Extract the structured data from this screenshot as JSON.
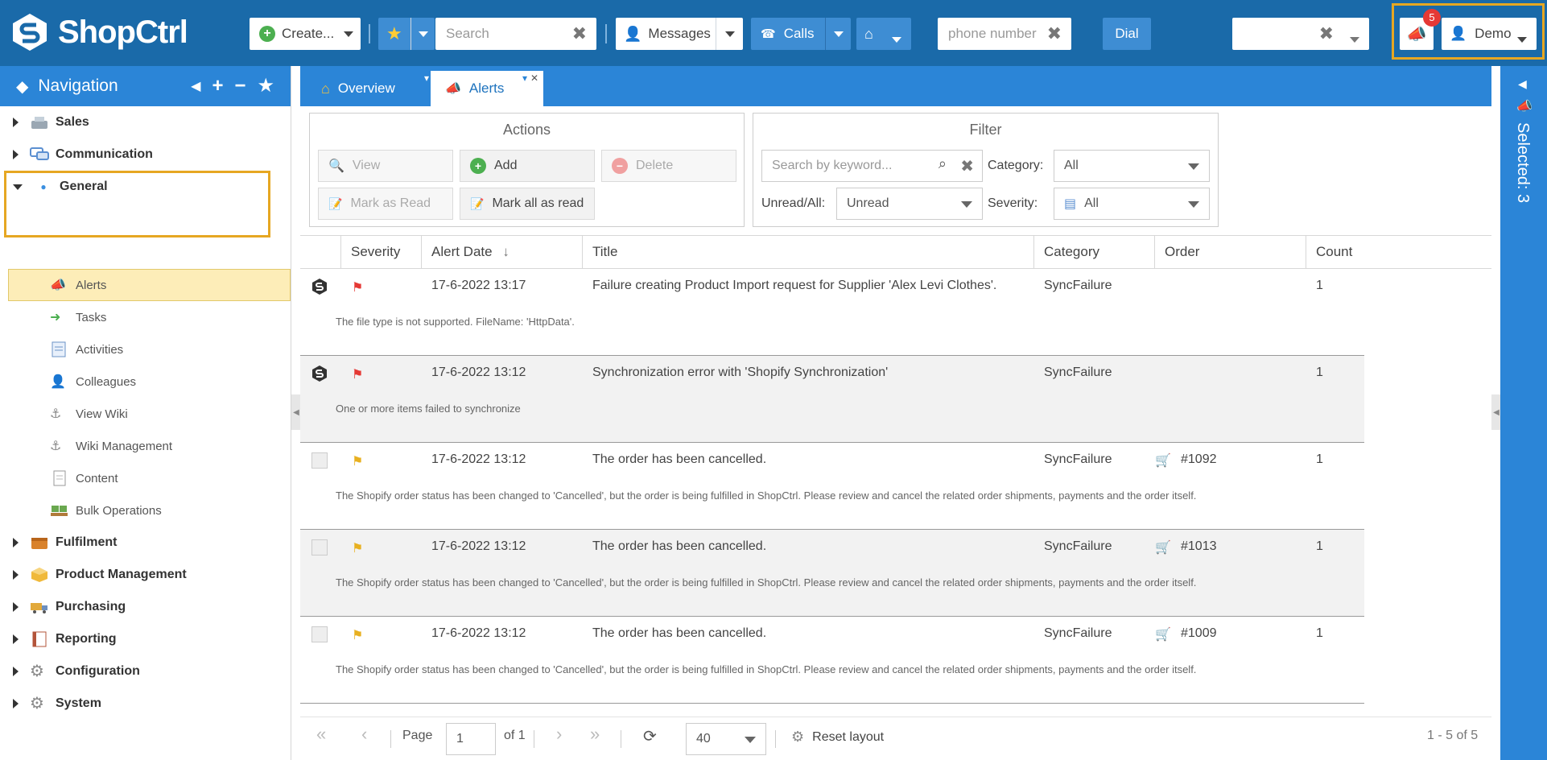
{
  "app": {
    "logo_text": "ShopCtrl"
  },
  "topbar": {
    "create_label": "Create...",
    "search_placeholder": "Search",
    "messages_label": "Messages",
    "calls_label": "Calls",
    "phone_placeholder": "phone number",
    "dial_label": "Dial",
    "user_label": "Demo",
    "alert_count": "5",
    "clear_glyph": "✖"
  },
  "nav": {
    "title": "Navigation",
    "items": [
      {
        "label": "Sales",
        "icon": "cash-register-icon",
        "type": "group"
      },
      {
        "label": "Communication",
        "icon": "chat-bubbles-icon",
        "type": "group"
      },
      {
        "label": "General",
        "icon": "dot-icon",
        "type": "group-open"
      },
      {
        "label": "Alerts",
        "icon": "megaphone-icon",
        "type": "sub"
      },
      {
        "label": "Tasks",
        "icon": "green-arrow-icon",
        "type": "sub"
      },
      {
        "label": "Activities",
        "icon": "notepad-icon",
        "type": "sub"
      },
      {
        "label": "Colleagues",
        "icon": "person-icon",
        "type": "sub"
      },
      {
        "label": "View Wiki",
        "icon": "anchor-icon",
        "type": "sub"
      },
      {
        "label": "Wiki Management",
        "icon": "anchor-icon",
        "type": "sub"
      },
      {
        "label": "Content",
        "icon": "document-icon",
        "type": "sub"
      },
      {
        "label": "Bulk Operations",
        "icon": "pallet-icon",
        "type": "sub"
      },
      {
        "label": "Fulfilment",
        "icon": "box-icon",
        "type": "group"
      },
      {
        "label": "Product Management",
        "icon": "cube-icon",
        "type": "group"
      },
      {
        "label": "Purchasing",
        "icon": "truck-icon",
        "type": "group"
      },
      {
        "label": "Reporting",
        "icon": "report-icon",
        "type": "group"
      },
      {
        "label": "Configuration",
        "icon": "gear-icon",
        "type": "group"
      },
      {
        "label": "System",
        "icon": "gear-icon",
        "type": "group"
      }
    ]
  },
  "tabs": [
    {
      "label": "Overview",
      "icon": "home-icon"
    },
    {
      "label": "Alerts",
      "icon": "megaphone-icon"
    }
  ],
  "actions": {
    "title": "Actions",
    "view": "View",
    "add": "Add",
    "delete": "Delete",
    "mark_read": "Mark as Read",
    "mark_all": "Mark all as read"
  },
  "filter": {
    "title": "Filter",
    "keyword_placeholder": "Search by keyword...",
    "category_label": "Category:",
    "category_value": "All",
    "unread_label": "Unread/All:",
    "unread_value": "Unread",
    "severity_label": "Severity:",
    "severity_value": "All"
  },
  "grid": {
    "columns": [
      "Severity",
      "Alert Date",
      "Title",
      "Category",
      "Order",
      "Count"
    ],
    "rows": [
      {
        "source": "shopify",
        "severity": "high",
        "date": "17-6-2022 13:17",
        "title": "Failure creating Product Import request for Supplier 'Alex Levi Clothes'.",
        "category": "SyncFailure",
        "order": "",
        "count": "1",
        "desc": "The file type is not supported. FileName: 'HttpData'."
      },
      {
        "source": "shopify",
        "severity": "high",
        "date": "17-6-2022 13:12",
        "title": "Synchronization error with 'Shopify Synchronization'",
        "category": "SyncFailure",
        "order": "",
        "count": "1",
        "desc": "One or more items failed to synchronize"
      },
      {
        "source": "doc",
        "severity": "medium",
        "date": "17-6-2022 13:12",
        "title": "The order has been cancelled.",
        "category": "SyncFailure",
        "order": "#1092",
        "count": "1",
        "desc": "The Shopify order status has been changed to 'Cancelled', but the order is being fulfilled in ShopCtrl. Please review and cancel the related order shipments, payments and the order itself."
      },
      {
        "source": "doc",
        "severity": "medium",
        "date": "17-6-2022 13:12",
        "title": "The order has been cancelled.",
        "category": "SyncFailure",
        "order": "#1013",
        "count": "1",
        "desc": "The Shopify order status has been changed to 'Cancelled', but the order is being fulfilled in ShopCtrl. Please review and cancel the related order shipments, payments and the order itself."
      },
      {
        "source": "doc",
        "severity": "medium",
        "date": "17-6-2022 13:12",
        "title": "The order has been cancelled.",
        "category": "SyncFailure",
        "order": "#1009",
        "count": "1",
        "desc": "The Shopify order status has been changed to 'Cancelled', but the order is being fulfilled in ShopCtrl. Please review and cancel the related order shipments, payments and the order itself."
      }
    ]
  },
  "pager": {
    "page_label": "Page",
    "page_value": "1",
    "of_label": "of 1",
    "page_size": "40",
    "reset_label": "Reset layout",
    "summary": "1 - 5 of 5"
  },
  "right_panel": {
    "label": "Selected: 3"
  },
  "colors": {
    "topbar": "#1a6aa9",
    "accent": "#2b85d7",
    "highlight": "#e6a722",
    "selection": "#fdedb8"
  }
}
